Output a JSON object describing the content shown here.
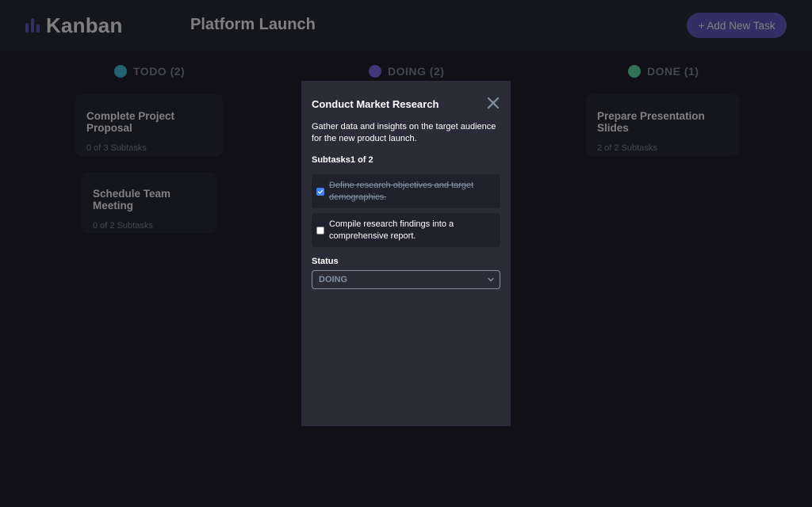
{
  "header": {
    "logo_text": "Kanban",
    "board_title": "Platform Launch",
    "add_task_label": "+ Add New Task"
  },
  "columns": [
    {
      "label": "TODO (2)",
      "dot_color": "#49c4e5",
      "cards": [
        {
          "title": "Complete Project Proposal",
          "subtasks": "0 of 3 Subtasks"
        },
        {
          "title": "Schedule Team Meeting",
          "subtasks": "0 of 2 Subtasks"
        }
      ]
    },
    {
      "label": "DOING (2)",
      "dot_color": "#8471f2",
      "cards": []
    },
    {
      "label": "DONE (1)",
      "dot_color": "#67e2ae",
      "cards": [
        {
          "title": "Prepare Presentation Slides",
          "subtasks": "2 of 2 Subtasks"
        }
      ]
    }
  ],
  "modal": {
    "title": "Conduct Market Research",
    "description": "Gather data and insights on the target audience for the new product launch.",
    "subtasks_label": "Subtasks1 of 2",
    "subtasks": [
      {
        "text": "Define research objectives and target demographics.",
        "checked": true
      },
      {
        "text": "Compile research findings into a comprehensive report.",
        "checked": false
      }
    ],
    "status_label": "Status",
    "status_value": "DOING",
    "close_icon": "close-icon"
  },
  "colors": {
    "accent": "#635fc7",
    "background": "#20212c",
    "surface": "#2b2c37",
    "muted_text": "#828fa3"
  }
}
